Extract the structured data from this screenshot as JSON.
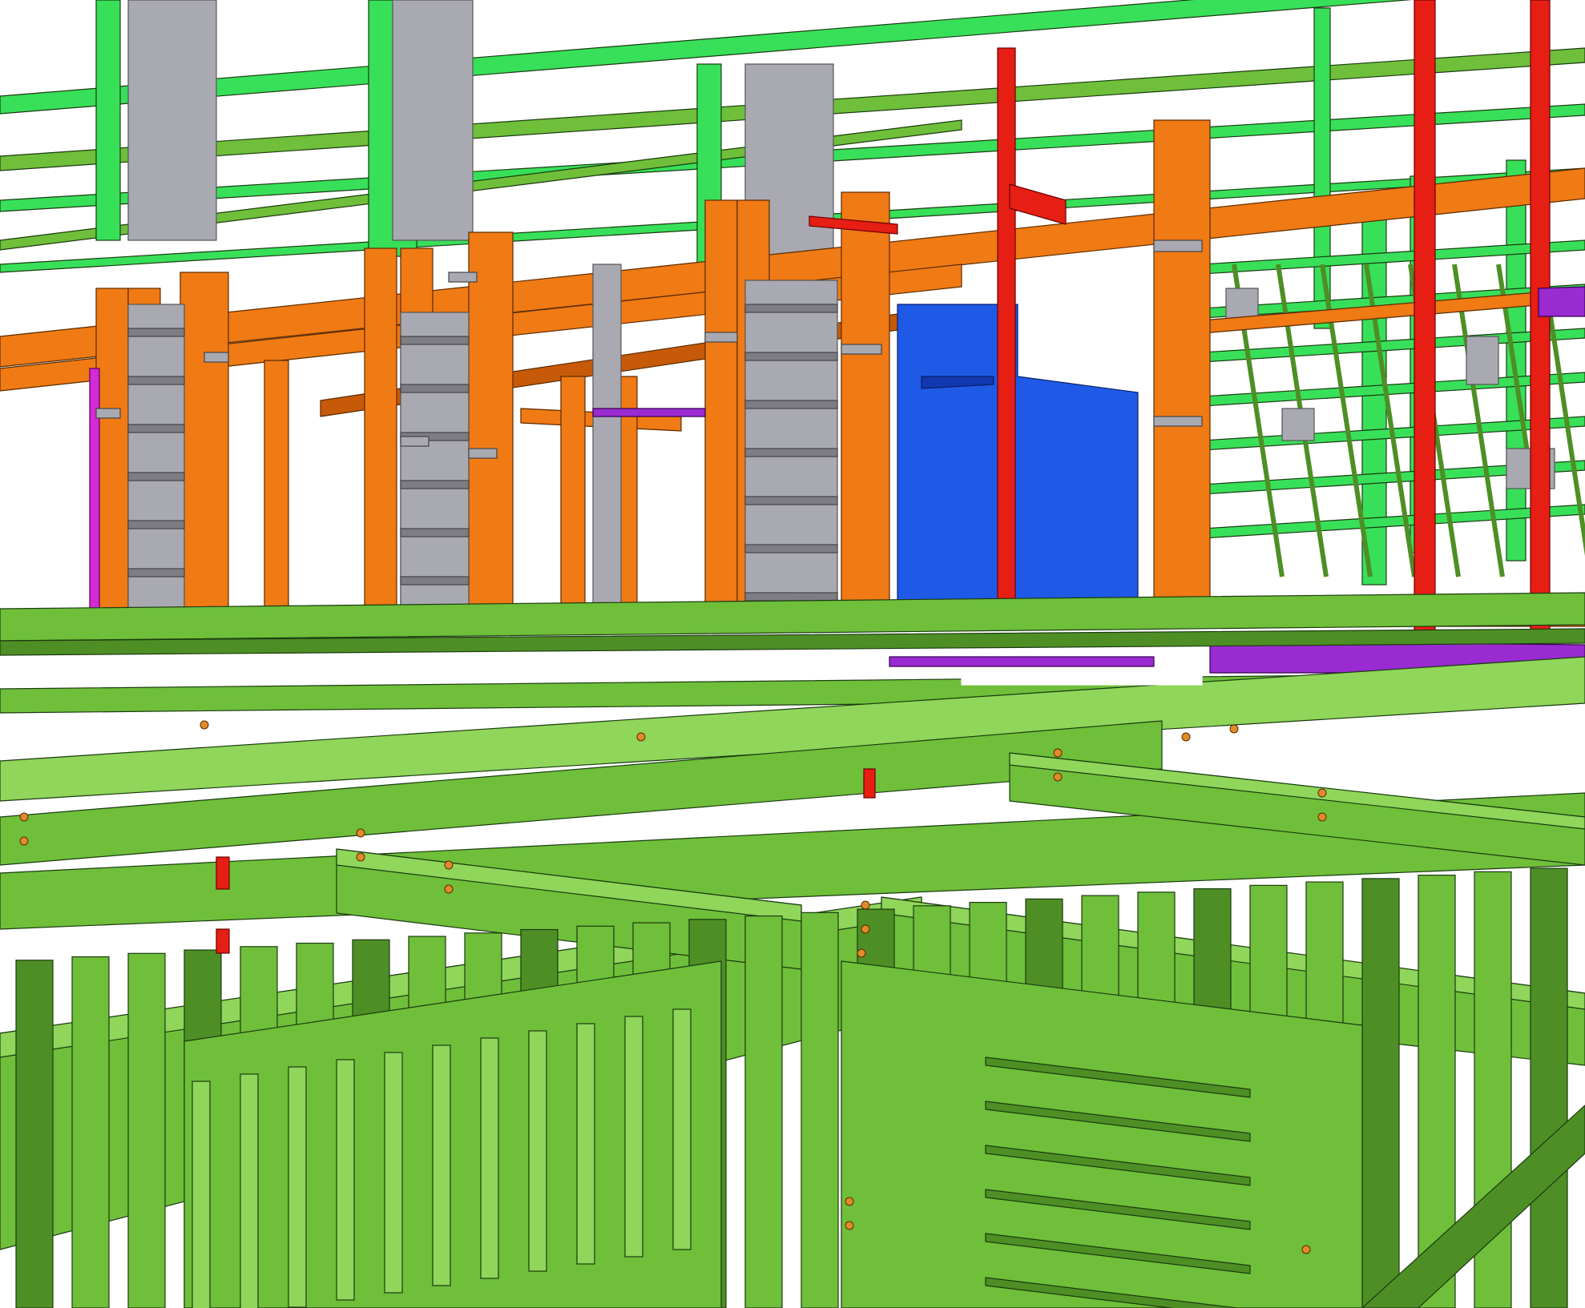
{
  "scene": {
    "description_visible_text": "",
    "colors": {
      "background": "#ffffff",
      "green_member": "#6fbf3a",
      "green_dark": "#4e8f25",
      "green_light": "#8fd65a",
      "bright_green": "#38e05a",
      "orange_member": "#f07a14",
      "orange_dark": "#c65a08",
      "red_member": "#e61e14",
      "blue_block": "#1e5ae6",
      "blue_dark": "#1238b0",
      "gray_plate": "#a9a9b2",
      "gray_dark": "#7d7d86",
      "purple_deck": "#9a2bd1",
      "magenta_member": "#d42ad8",
      "bolt": "#e08a2a"
    },
    "icons": [
      "steel-frame-3d-model"
    ]
  }
}
